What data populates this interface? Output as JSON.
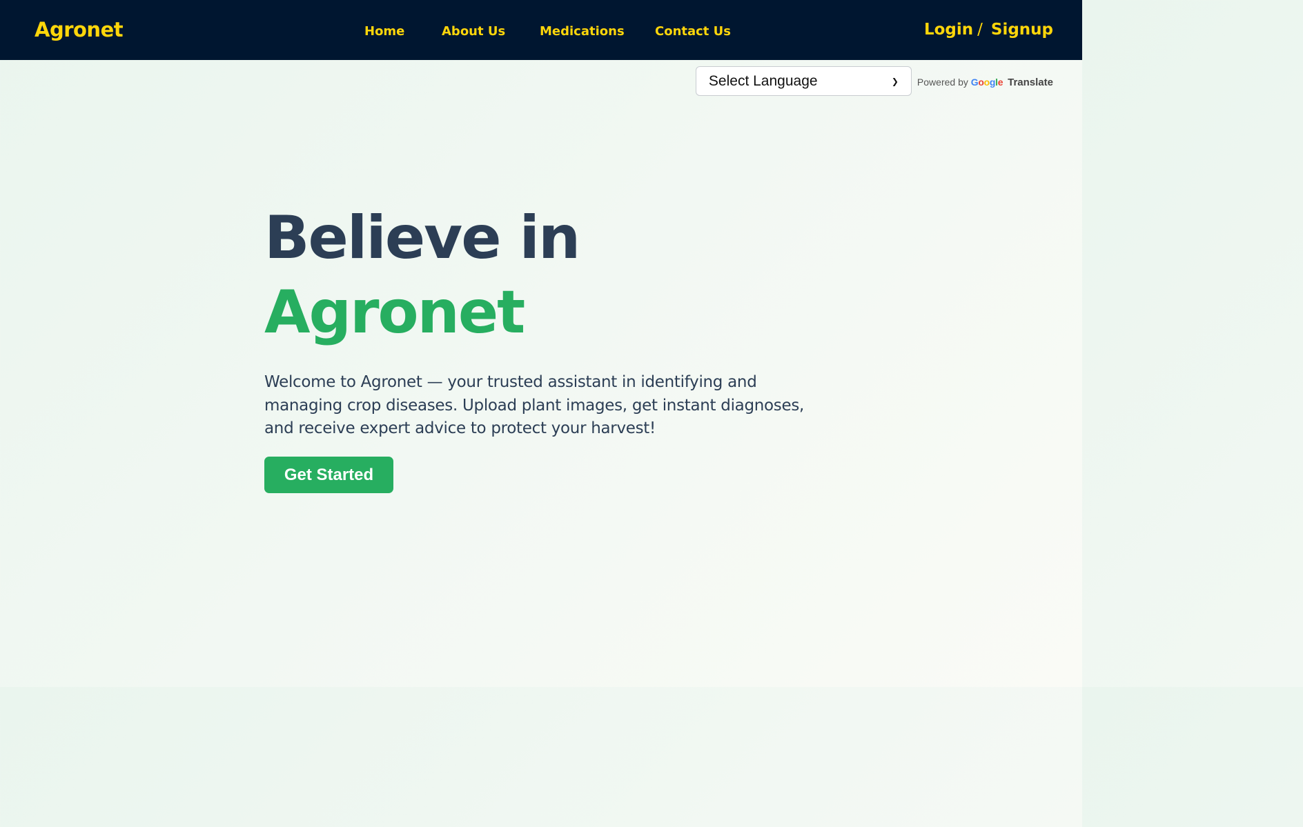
{
  "navbar": {
    "brand": "Agronet",
    "links": [
      "Home",
      "About Us",
      "Medications",
      "Contact Us"
    ],
    "login": "Login",
    "separator": "/",
    "signup": "Signup"
  },
  "translate": {
    "select_value": "Select Language",
    "powered_by": "Powered by",
    "google": [
      "G",
      "o",
      "o",
      "g",
      "l",
      "e"
    ],
    "translate_word": "Translate"
  },
  "hero": {
    "title_line1": "Believe in",
    "title_line2": "Agronet",
    "description": "Welcome to Agronet — your trusted assistant in identifying and managing crop diseases. Upload plant images, get instant diagnoses, and receive expert advice to protect your harvest!",
    "cta_label": "Get Started"
  },
  "colors": {
    "navbar_bg": "#001630",
    "accent_yellow": "#ffd60a",
    "heading_dark": "#2c3e55",
    "brand_green": "#27ae60"
  }
}
